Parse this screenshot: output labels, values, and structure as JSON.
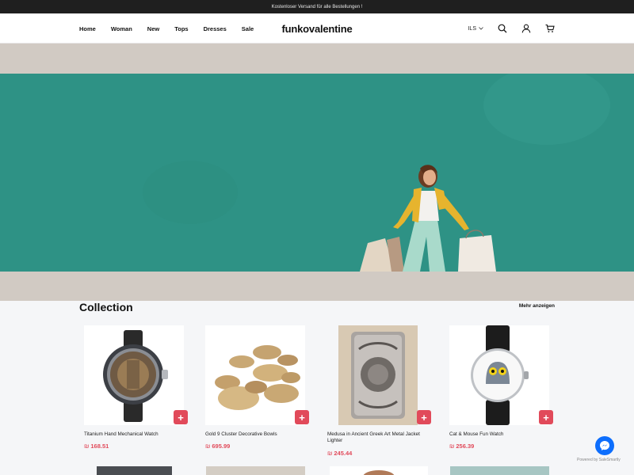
{
  "announcement": "Kostenloser Versand für alle Bestellungen !",
  "nav": [
    "Home",
    "Woman",
    "New",
    "Tops",
    "Dresses",
    "Sale"
  ],
  "brand": "funkovalentine",
  "currency": "ILS",
  "icons": [
    "search-icon",
    "user-icon",
    "cart-icon"
  ],
  "colors": {
    "hero_teal": "#2e9285",
    "hero_beige": "#d1cac3",
    "price": "#e14a5a",
    "add_button": "#e14a5a"
  },
  "collection": {
    "title": "Collection",
    "more": "Mehr anzeigen",
    "currency_symbol": "₪",
    "add_label": "+",
    "products": [
      {
        "name": "Titanium Hand Mechanical Watch",
        "price": "168.51"
      },
      {
        "name": "Gold 9 Cluster Decorative Bowls",
        "price": "695.99"
      },
      {
        "name": "Medusa in Ancient Greek Art Metal Jacket Lighter",
        "price": "245.44"
      },
      {
        "name": "Cat & Mouse Fun Watch",
        "price": "256.39"
      }
    ]
  },
  "widget": {
    "powered_by": "Powered by SaleSmartly"
  }
}
